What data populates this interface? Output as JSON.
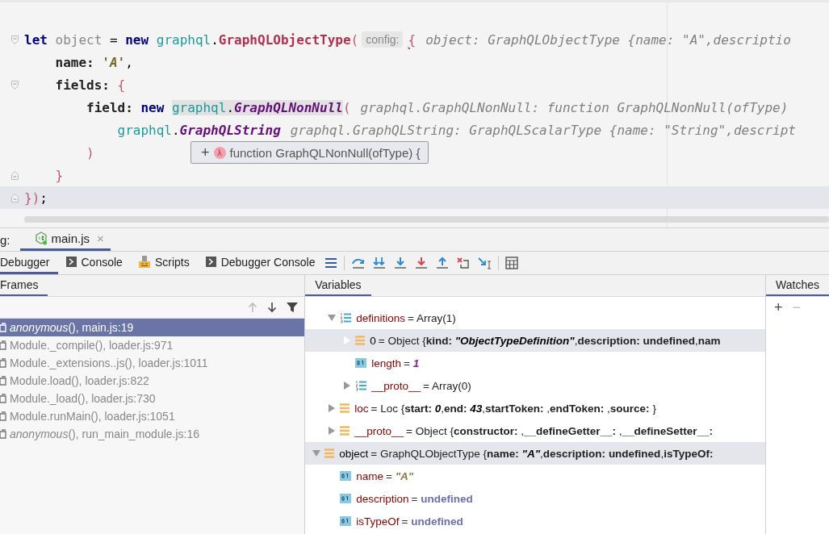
{
  "editor": {
    "lines": [
      {
        "kind": "fold-start",
        "current": false,
        "segments": [
          {
            "kind": "code",
            "tokens": [
              {
                "kind": "keyword",
                "text": "let",
                "space_after": true
              },
              {
                "kind": "muted",
                "text": "object",
                "space_after": true
              },
              {
                "kind": "plain",
                "text": "=",
                "space_after": true
              },
              {
                "kind": "keyword",
                "text": "new",
                "space_after": true
              },
              {
                "kind": "ns",
                "text": "graphql",
                "space_after": false
              },
              {
                "kind": "plain",
                "text": ".",
                "space_after": false
              },
              {
                "kind": "cls",
                "text": "GraphQLObjectType",
                "space_after": false
              },
              {
                "kind": "brace",
                "text": "(",
                "space_after": false
              }
            ]
          },
          {
            "kind": "hint",
            "text": "config:"
          },
          {
            "kind": "code",
            "tokens": [
              {
                "kind": "error-brace",
                "text": "{",
                "space_after": false
              }
            ]
          },
          {
            "kind": "value",
            "text": "object: GraphQLObjectType {name: \"A\",descriptio"
          }
        ],
        "children": [
          {
            "kind": "plain",
            "current": false,
            "segments": [
              {
                "kind": "code",
                "tokens": [
                  {
                    "kind": "prop",
                    "text": "name:",
                    "space_after": true
                  },
                  {
                    "kind": "str",
                    "text": "'A'",
                    "space_after": false
                  },
                  {
                    "kind": "plain",
                    "text": ",",
                    "space_after": false
                  }
                ]
              }
            ]
          },
          {
            "kind": "fold-start",
            "current": false,
            "segments": [
              {
                "kind": "code",
                "tokens": [
                  {
                    "kind": "prop",
                    "text": "fields:",
                    "space_after": true
                  },
                  {
                    "kind": "brace",
                    "text": "{",
                    "space_after": false
                  }
                ]
              }
            ],
            "children": [
              {
                "kind": "plain",
                "current": false,
                "segments": [
                  {
                    "kind": "code",
                    "tokens": [
                      {
                        "kind": "prop",
                        "text": "field:",
                        "space_after": true
                      },
                      {
                        "kind": "keyword",
                        "text": "new",
                        "space_after": true
                      },
                      {
                        "kind": "ns-mark",
                        "text": "graphql",
                        "space_after": false
                      },
                      {
                        "kind": "plain-mark",
                        "text": ".",
                        "space_after": false
                      },
                      {
                        "kind": "cls-italic-mark",
                        "text": "GraphQLNonNull",
                        "space_after": false
                      },
                      {
                        "kind": "brace",
                        "text": "(",
                        "space_after": false
                      }
                    ]
                  },
                  {
                    "kind": "value",
                    "text": "graphql.GraphQLNonNull: function GraphQLNonNull(ofType)"
                  }
                ],
                "children": [
                  {
                    "kind": "plain",
                    "current": false,
                    "segments": [
                      {
                        "kind": "code",
                        "tokens": [
                          {
                            "kind": "ns",
                            "text": "graphql",
                            "space_after": false
                          },
                          {
                            "kind": "plain",
                            "text": ".",
                            "space_after": false
                          },
                          {
                            "kind": "cls-italic",
                            "text": "GraphQLString",
                            "space_after": false
                          }
                        ]
                      },
                      {
                        "kind": "value",
                        "text": "graphql.GraphQLString: GraphQLScalarType {name: \"String\",descript"
                      }
                    ]
                  }
                ]
              },
              {
                "kind": "plain",
                "current": false,
                "segments": [
                  {
                    "kind": "code",
                    "tokens": [
                      {
                        "kind": "brace",
                        "text": ")",
                        "space_after": false
                      }
                    ]
                  }
                ]
              }
            ]
          },
          {
            "kind": "fold-end",
            "current": false,
            "segments": [
              {
                "kind": "code",
                "tokens": [
                  {
                    "kind": "brace",
                    "text": "}",
                    "space_after": false
                  }
                ]
              }
            ]
          }
        ]
      },
      {
        "kind": "fold-end",
        "current": true,
        "segments": [
          {
            "kind": "code",
            "tokens": [
              {
                "kind": "brace",
                "text": "})",
                "space_after": false
              },
              {
                "kind": "plain",
                "text": ";",
                "space_after": false
              }
            ]
          }
        ]
      }
    ],
    "popup": {
      "expand": "+",
      "badge": "λ",
      "text": "function GraphQLNonNull(ofType) {"
    }
  },
  "debug_bar": {
    "label": "g:",
    "tabs": [
      {
        "label": "main.js",
        "close": "×",
        "selected": true
      }
    ]
  },
  "tool_tabs": [
    {
      "label": "Debugger",
      "selected": true
    },
    {
      "label": "Console",
      "selected": false
    },
    {
      "label": "Scripts",
      "selected": false
    },
    {
      "label": "Debugger Console",
      "selected": false
    }
  ],
  "frames": {
    "title": "Frames",
    "toolbar": [
      {
        "kind": "up",
        "disabled": true
      },
      {
        "kind": "down",
        "disabled": false
      },
      {
        "kind": "filter",
        "disabled": false
      }
    ],
    "items": [
      {
        "text": "*anonymous*(), main.js:19",
        "selected": true
      },
      {
        "text": "Module._compile(), loader.js:971",
        "selected": false
      },
      {
        "text": "Module._extensions..js(), loader.js:1011",
        "selected": false
      },
      {
        "text": "Module.load(), loader.js:822",
        "selected": false
      },
      {
        "text": "Module._load(), loader.js:730",
        "selected": false
      },
      {
        "text": "Module.runMain(), loader.js:1051",
        "selected": false
      },
      {
        "text": "*anonymous*(), run_main_module.js:16",
        "selected": false
      }
    ]
  },
  "variables": {
    "title": "Variables",
    "continued_items": [
      {
        "name": "definitions",
        "kind": "array",
        "expanded": true,
        "selected": false,
        "value": "= Array(1)",
        "children": [
          {
            "name": "0",
            "kind": "element",
            "expanded": false,
            "selected": true,
            "value": "= Object {**kind:** *\"ObjectTypeDefinition\"*,**description:** **undefined**,**nam**"
          },
          {
            "name": "length",
            "kind": "number",
            "selected": false,
            "value": "= *1*"
          },
          {
            "name": "__proto__",
            "kind": "array",
            "expanded": false,
            "selected": false,
            "value": "= Array(0)"
          }
        ]
      },
      {
        "name": "loc",
        "kind": "object",
        "expanded": false,
        "selected": false,
        "value": "= Loc {**start:** *0*,**end:** *43*,**startToken:** ,**endToken:** ,**source:** }"
      },
      {
        "name": "__proto__",
        "kind": "object",
        "expanded": false,
        "selected": false,
        "value": "= Object {**constructor:** ,**__defineGetter__:** ,**__defineSetter__:**"
      }
    ],
    "items": [
      {
        "name": "object",
        "kind": "local",
        "expanded": true,
        "selected": true,
        "value": "= GraphQLObjectType {**name:** *\"A\"*,**description:** **undefined**,**isTypeOf:**",
        "children": [
          {
            "name": "name",
            "kind": "string",
            "selected": false,
            "value": "= *\"A\"*"
          },
          {
            "name": "description",
            "kind": "undefined",
            "selected": false,
            "value": "= **undefined**"
          },
          {
            "name": "isTypeOf",
            "kind": "undefined",
            "selected": false,
            "value": "= **undefined**"
          }
        ]
      }
    ]
  },
  "watches": {
    "title": "Watches",
    "toolbar": [
      {
        "text": "+",
        "disabled": false
      },
      {
        "text": "−",
        "disabled": true
      }
    ]
  }
}
